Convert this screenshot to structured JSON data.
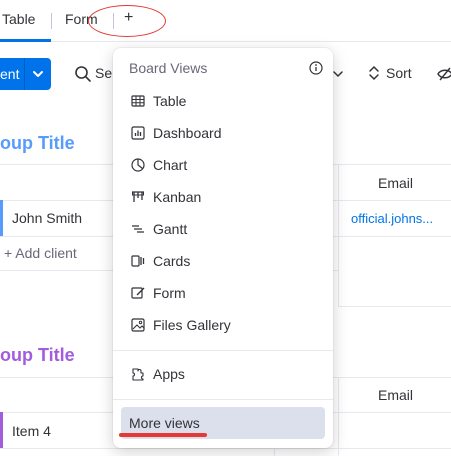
{
  "tabs": {
    "table_label": "Table",
    "form_label": "Form",
    "add_label": "+"
  },
  "toolbar": {
    "new_label": "ent",
    "search_label": "Se",
    "sort_label": "Sort"
  },
  "groups": [
    {
      "title": "oup Title",
      "email_header": "Email",
      "rows": [
        {
          "name": "John Smith",
          "email": "official.johns..."
        }
      ],
      "add_label": "+ Add client"
    },
    {
      "title": "oup Title",
      "email_header": "Email",
      "rows": [
        {
          "name": "Item 4",
          "email": ""
        }
      ]
    }
  ],
  "menu": {
    "heading": "Board Views",
    "items": [
      {
        "label": "Table",
        "icon": "table-icon"
      },
      {
        "label": "Dashboard",
        "icon": "dashboard-icon"
      },
      {
        "label": "Chart",
        "icon": "chart-icon"
      },
      {
        "label": "Kanban",
        "icon": "kanban-icon"
      },
      {
        "label": "Gantt",
        "icon": "gantt-icon"
      },
      {
        "label": "Cards",
        "icon": "cards-icon"
      },
      {
        "label": "Form",
        "icon": "form-icon"
      },
      {
        "label": "Files Gallery",
        "icon": "files-gallery-icon"
      }
    ],
    "apps_label": "Apps",
    "more_views_label": "More views"
  },
  "colors": {
    "accent": "#0073ea",
    "group1": "#579bfc",
    "group2": "#a25ddc",
    "annotation": "#e53935"
  }
}
